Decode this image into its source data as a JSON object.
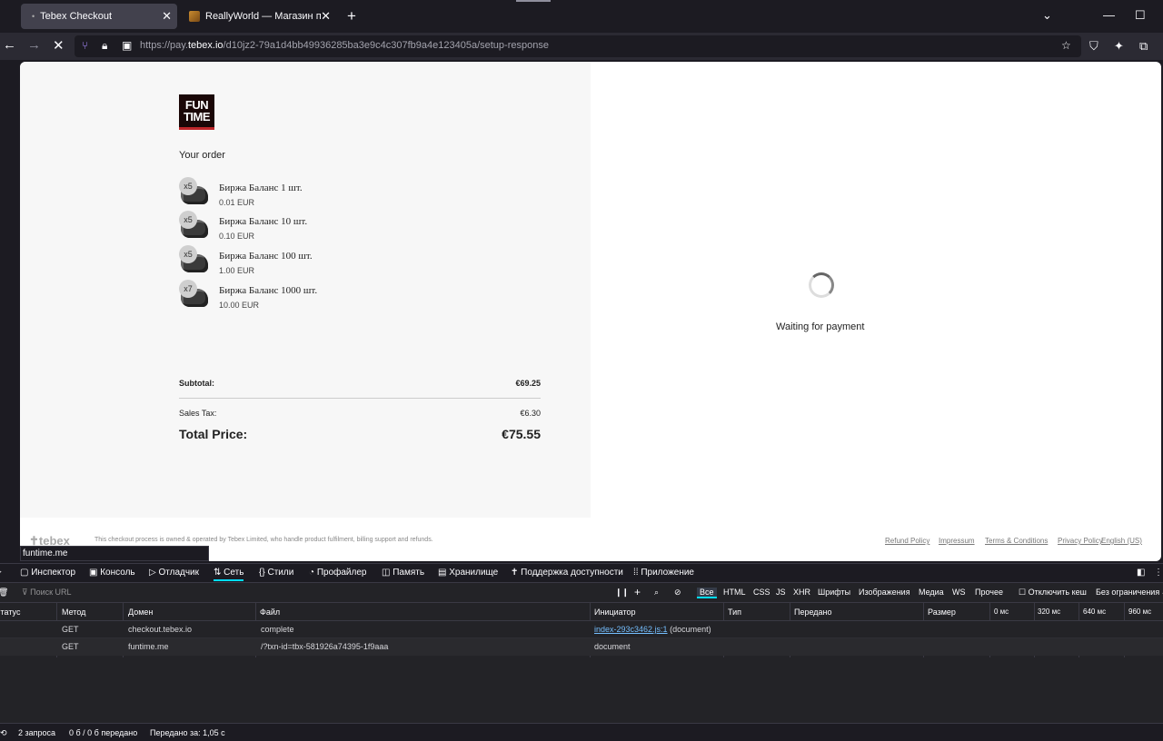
{
  "tabs": [
    {
      "title": "Tebex Checkout",
      "active": true
    },
    {
      "title": "ReallyWorld — Магазин приви",
      "active": false
    }
  ],
  "address_bar": {
    "url_prefix": "https://pay.",
    "url_domain": "tebex.io",
    "url_rest": "/d10jz2-79a1d4bb49936285ba3e9c4c307fb9a4e123405a/setup-response"
  },
  "store": {
    "logo_top": "FUN",
    "logo_bottom": "TIME"
  },
  "order": {
    "heading": "Your order",
    "items": [
      {
        "qty": "x5",
        "name": "Биржа Баланс 1 шт.",
        "price": "0.01 EUR"
      },
      {
        "qty": "x5",
        "name": "Биржа Баланс 10 шт.",
        "price": "0.10 EUR"
      },
      {
        "qty": "x5",
        "name": "Биржа Баланс 100 шт.",
        "price": "1.00 EUR"
      },
      {
        "qty": "x7",
        "name": "Биржа Баланс 1000 шт.",
        "price": "10.00 EUR"
      }
    ],
    "subtotal_label": "Subtotal:",
    "subtotal": "€69.25",
    "tax_label": "Sales Tax:",
    "tax": "€6.30",
    "total_label": "Total Price:",
    "total": "€75.55"
  },
  "payment": {
    "status": "Waiting for payment"
  },
  "footer": {
    "brand": "tebex",
    "note": "This checkout process is owned & operated by Tebex Limited, who handle product fulfilment, billing support and refunds.",
    "links": [
      "Refund Policy",
      "Impressum",
      "Terms & Conditions",
      "Privacy Policy",
      "English (US)"
    ]
  },
  "status_url": "funtime.me",
  "devtools": {
    "tabs": [
      "Инспектор",
      "Консоль",
      "Отладчик",
      "Сеть",
      "Стили",
      "Профайлер",
      "Память",
      "Хранилище",
      "Поддержка доступности",
      "Приложение"
    ],
    "active_tab": "Сеть",
    "filter_placeholder": "Поиск URL",
    "type_filters": [
      "Все",
      "HTML",
      "CSS",
      "JS",
      "XHR",
      "Шрифты",
      "Изображения",
      "Медиа",
      "WS",
      "Прочее"
    ],
    "disable_cache": "Отключить кеш",
    "throttle": "Без ограничения",
    "columns": [
      "Статус",
      "Метод",
      "Домен",
      "Файл",
      "Инициатор",
      "Тип",
      "Передано",
      "Размер"
    ],
    "timeline": [
      "0 мс",
      "320 мс",
      "640 мс",
      "960 мс"
    ],
    "requests": [
      {
        "method": "GET",
        "domain": "checkout.tebex.io",
        "file": "complete",
        "initiator_link": "index-293c3462.js:1",
        "initiator_rest": "(document)"
      },
      {
        "method": "GET",
        "domain": "funtime.me",
        "file": "/?txn-id=tbx-581926a74395-1f9aaa",
        "initiator_link": "",
        "initiator_rest": "document"
      }
    ],
    "summary": {
      "requests": "2 запроса",
      "transferred": "0 б / 0 б передано",
      "time": "Передано за: 1,05 с"
    }
  }
}
